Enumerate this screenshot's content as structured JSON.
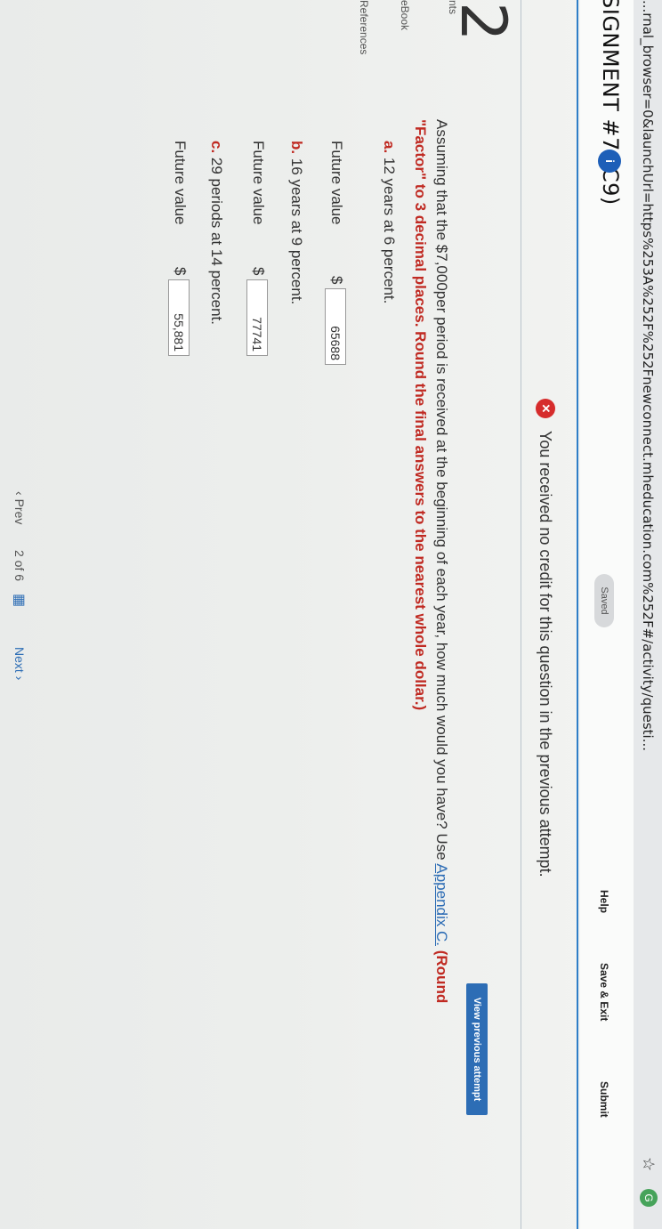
{
  "browser": {
    "url": "...rnal_browser=0&launchUrl=https%253A%252F%252Fnewconnect.mheducation.com%252F#/activity/questi..."
  },
  "header": {
    "title": "SIGNMENT #7 (C9)",
    "info_icon": "info-icon",
    "saved": "Saved",
    "help": "Help",
    "save_exit": "Save & Exit",
    "submit": "Submit"
  },
  "notice": {
    "text": "You received no credit for this question in the previous attempt."
  },
  "question": {
    "number": "2",
    "view_previous": "View previous attempt",
    "sidebar": [
      "nts",
      "eBook",
      "References"
    ],
    "text_lead": "Assuming that the $7,000per period is received at the beginning of each year, how much would you have? Use",
    "appendix_link": "Appendix C.",
    "round_note_1": "(Round",
    "round_note_2": "\"Factor\" to 3 decimal places. Round the final answers to the nearest whole dollar.)",
    "parts": [
      {
        "letter": "a.",
        "text": "12 years at 6 percent.",
        "label": "Future value",
        "currency": "$",
        "value": "65688"
      },
      {
        "letter": "b.",
        "text": "16 years at 9 percent.",
        "label": "Future value",
        "currency": "$",
        "value": "77741"
      },
      {
        "letter": "c.",
        "text": "29 periods at 14 percent.",
        "label": "Future value",
        "currency": "$",
        "value": "55,881"
      }
    ]
  },
  "footer": {
    "prev": "Prev",
    "page_count": "2 of 6",
    "next": "Next"
  }
}
